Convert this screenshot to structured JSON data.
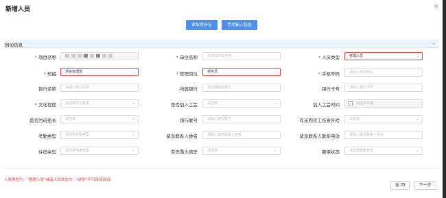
{
  "dialog": {
    "title": "新增人员",
    "close_icon": "close-icon"
  },
  "actions": {
    "read_id_card": "读取身份证",
    "manual_input": "手动输入信息"
  },
  "section": {
    "title": "附加信息"
  },
  "fields": {
    "project_name": {
      "label": "项目名称",
      "value": ""
    },
    "unit_name": {
      "label": "单位名称",
      "placeholder": "请选择单位名称"
    },
    "person_type": {
      "label": "人员类型",
      "value": "管理人员"
    },
    "team": {
      "label": "班组",
      "value": "项目管理部"
    },
    "mgmt_post": {
      "label": "管理岗位",
      "value": "劳务员"
    },
    "phone": {
      "label": "手机号码",
      "placeholder": "请输入手机号码"
    },
    "bank_name": {
      "label": "银行名称",
      "placeholder": "请输入银行名称"
    },
    "bank": {
      "label": "所属银行",
      "placeholder": "请选择所属银行"
    },
    "bank_card": {
      "label": "银行卡号",
      "placeholder": "请输入银行卡号"
    },
    "education": {
      "label": "文化程度",
      "placeholder": "请选择文化程度"
    },
    "joined_union": {
      "label": "是否加入工会",
      "placeholder": "请选择"
    },
    "union_join_time": {
      "label": "加入工会时间",
      "placeholder": "请选择日期"
    },
    "is_team_leader": {
      "label": "是否为班组长",
      "placeholder": "请选择"
    },
    "bank_account_no": {
      "label": "银行联号",
      "placeholder": "请输入银行联号"
    },
    "accident_insurance": {
      "label": "有无购买工伤意外险",
      "placeholder": "请选择"
    },
    "attendance_type": {
      "label": "考勤类型",
      "placeholder": "请选择考勤类型"
    },
    "emergency_name": {
      "label": "紧急联系人姓名",
      "placeholder": "请输入紧急联系人姓名"
    },
    "emergency_phone": {
      "label": "紧急联系人联系电话",
      "placeholder": "请输入紧急联系人电话"
    },
    "housing_type": {
      "label": "住宿类型",
      "placeholder": "请选择住宿类型"
    },
    "major_illness": {
      "label": "有无重大病史",
      "placeholder": "请选择"
    },
    "employment_status": {
      "label": "聘用状态",
      "placeholder": "请选择聘用状态"
    }
  },
  "note": "人员类型为：“管理人员”或者人员状态为：“进场”不可修改班组！",
  "footer": {
    "back": "返 回",
    "next": "下一步"
  },
  "colors": {
    "accent": "#4d8ef0",
    "highlight": "#e53935"
  }
}
